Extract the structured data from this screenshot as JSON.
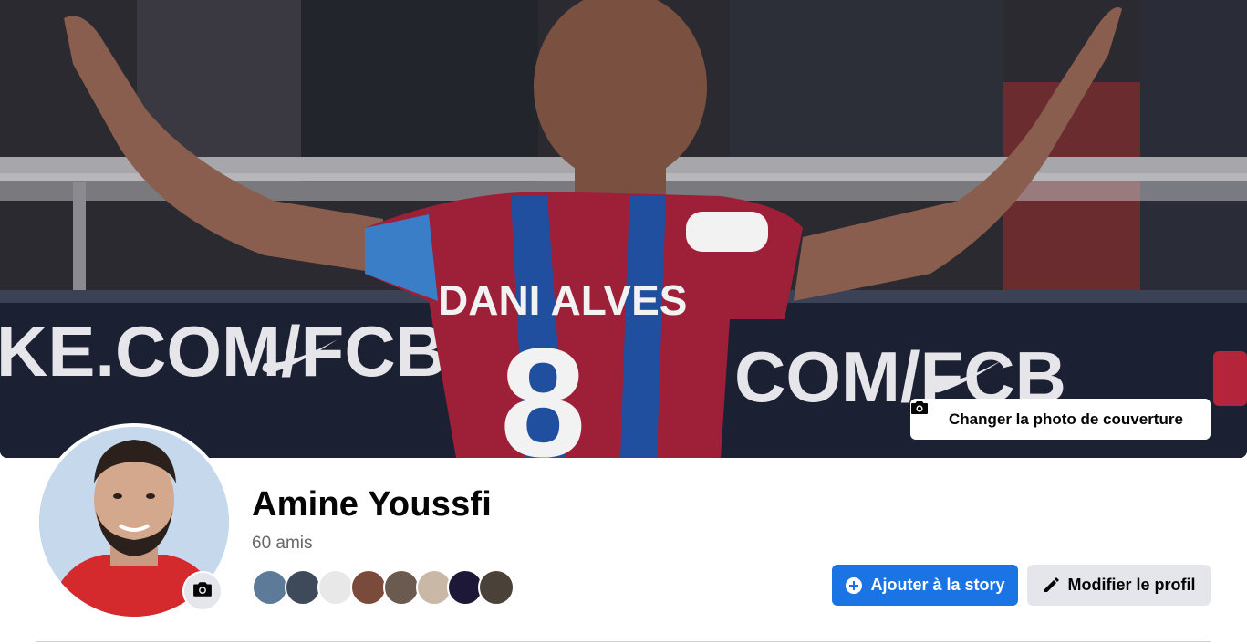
{
  "cover": {
    "change_button_label": "Changer la photo de couverture",
    "icon": "camera-icon",
    "banner_text_left": "KE.COM/FCB",
    "banner_text_right": "COM/FCB",
    "jersey_name": "DANI ALVES",
    "jersey_number": "8"
  },
  "profile": {
    "name": "Amine Youssfi",
    "friends_count_label": "60 amis",
    "avatar_camera_icon": "camera-icon",
    "friend_avatars": [
      {
        "color": "#5d7a99"
      },
      {
        "color": "#3e4a5a"
      },
      {
        "color": "#e8e8e8"
      },
      {
        "color": "#7a4a3a"
      },
      {
        "color": "#6b5a50"
      },
      {
        "color": "#c9b8a6"
      },
      {
        "color": "#1e1838"
      },
      {
        "color": "#4a4238"
      }
    ]
  },
  "actions": {
    "add_story_label": "Ajouter à la story",
    "add_story_icon": "plus-circle-icon",
    "edit_profile_label": "Modifier le profil",
    "edit_profile_icon": "pencil-icon",
    "primary_color": "#1b74e4",
    "secondary_color": "#e4e6eb"
  }
}
